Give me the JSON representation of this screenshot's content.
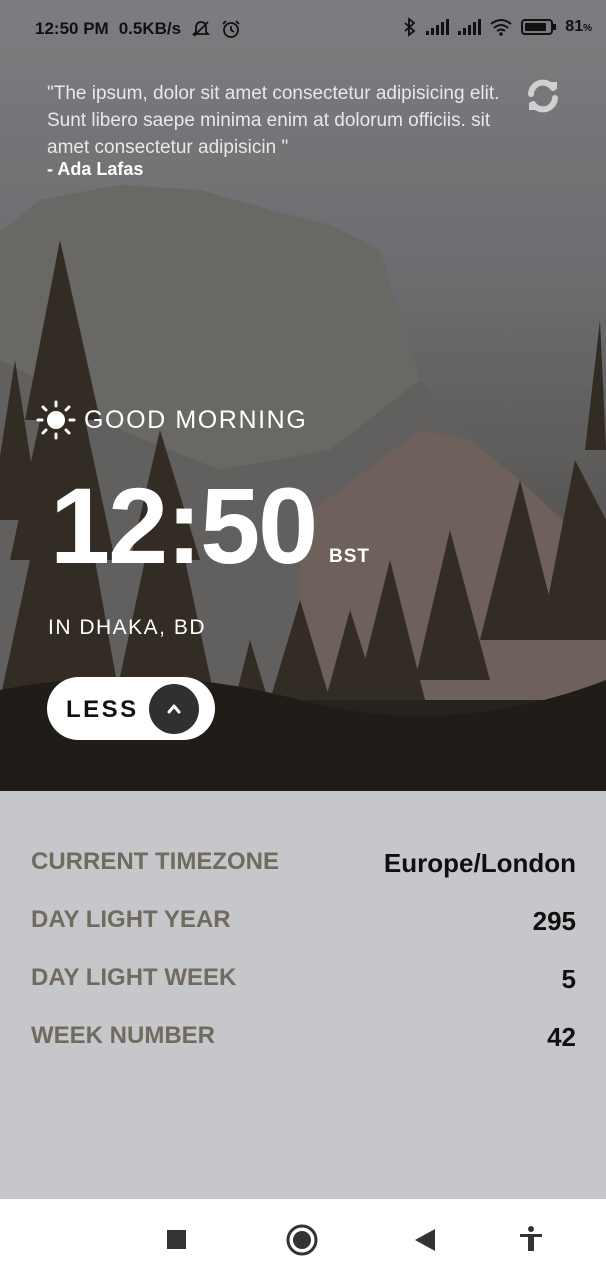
{
  "status_bar": {
    "time": "12:50 PM",
    "speed": "0.5KB/s",
    "battery": "81",
    "battery_unit": "%",
    "icons": [
      "mute-bell-icon",
      "alarm-icon",
      "bluetooth-icon",
      "signal-icon",
      "signal-icon",
      "wifi-icon",
      "battery-icon"
    ]
  },
  "quote": {
    "text": "\"The ipsum, dolor sit amet consectetur adipisicing elit. Sunt libero saepe minima enim at dolorum officiis. sit amet consectetur adipisicin \"",
    "author": "- Ada Lafas",
    "refresh_icon": "refresh-icon"
  },
  "clock": {
    "greeting": "GOOD MORNING",
    "greeting_icon": "sun-icon",
    "time": "12:50",
    "zone_abbr": "BST",
    "location": "IN DHAKA, BD"
  },
  "toggle": {
    "label": "LESS",
    "icon": "chevron-up-icon"
  },
  "details": [
    {
      "key": "CURRENT TIMEZONE",
      "value": "Europe/London"
    },
    {
      "key": "DAY LIGHT YEAR",
      "value": "295"
    },
    {
      "key": "DAY LIGHT WEEK",
      "value": "5"
    },
    {
      "key": "WEEK NUMBER",
      "value": "42"
    }
  ],
  "nav": {
    "icons": [
      "recents-square-icon",
      "home-circle-icon",
      "back-triangle-icon",
      "accessibility-icon"
    ]
  },
  "colors": {
    "panel_bg": "#c6c7cb",
    "label_color": "#716b5f",
    "value_color": "#101010",
    "button_bg": "#ffffff",
    "chevron_bg": "#303030"
  }
}
